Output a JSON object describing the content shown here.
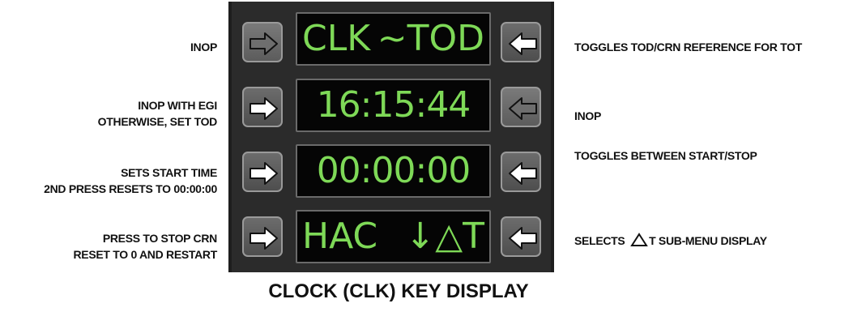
{
  "title": "CLOCK (CLK) KEY DISPLAY",
  "rows": [
    {
      "left_label": [
        "INOP"
      ],
      "right_label": [
        "TOGGLES TOD/CRN REFERENCE FOR TOT"
      ],
      "display_left": "CLK",
      "display_right": "~TOD",
      "left_key_state": "inactive",
      "right_key_state": "active"
    },
    {
      "left_label": [
        "INOP WITH EGI",
        "OTHERWISE, SET TOD"
      ],
      "right_label": [
        "INOP"
      ],
      "display_text": "16:15:44",
      "left_key_state": "active",
      "right_key_state": "inactive"
    },
    {
      "left_label": [
        "SETS START TIME",
        "2ND PRESS RESETS TO 00:00:00"
      ],
      "right_label": [
        "TOGGLES BETWEEN START/STOP"
      ],
      "display_text": "00:00:00",
      "left_key_state": "active",
      "right_key_state": "active"
    },
    {
      "left_label": [
        "PRESS TO STOP CRN",
        "RESET TO 0 AND RESTART"
      ],
      "right_label_prefix": "SELECTS",
      "right_label_suffix": "T SUB-MENU DISPLAY",
      "display_left": "HAC",
      "display_right": "↓△T",
      "left_key_state": "active",
      "right_key_state": "active"
    }
  ],
  "colors": {
    "panel": "#2b2b2b",
    "display_bg": "#050505",
    "display_text": "#7ed957",
    "arrow_active": "#ffffff",
    "arrow_inactive": "#6e6e6e"
  },
  "icons": [
    "arrow-right-icon",
    "arrow-left-icon",
    "delta-triangle-icon"
  ]
}
